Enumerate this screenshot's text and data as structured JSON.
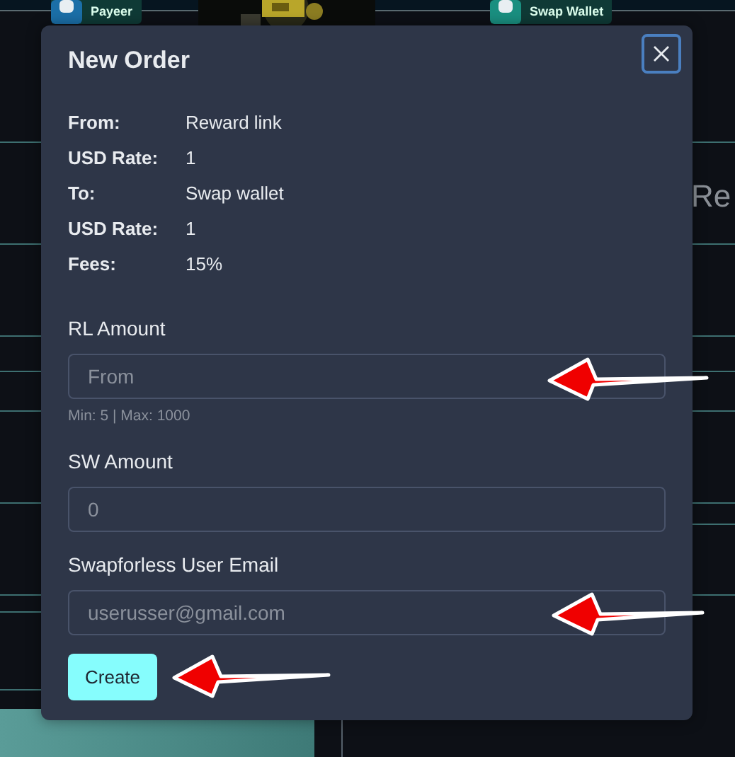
{
  "background": {
    "badges": [
      {
        "label": "Payeer",
        "color": "#1b6fa8"
      },
      {
        "label": "Swap Wallet",
        "color": "#1a8f80"
      }
    ],
    "heading": "Re"
  },
  "modal": {
    "title": "New Order",
    "details": [
      {
        "label": "From:",
        "value": "Reward link"
      },
      {
        "label": "USD Rate:",
        "value": "1"
      },
      {
        "label": "To:",
        "value": "Swap wallet"
      },
      {
        "label": "USD Rate:",
        "value": "1"
      },
      {
        "label": "Fees:",
        "value": "15%"
      }
    ],
    "fields": [
      {
        "label": "RL Amount",
        "placeholder": "From",
        "hint": "Min: 5 | Max: 1000"
      },
      {
        "label": "SW Amount",
        "placeholder": "0"
      },
      {
        "label": "Swapforless User Email",
        "placeholder": "userusser@gmail.com"
      }
    ],
    "submit": "Create"
  }
}
